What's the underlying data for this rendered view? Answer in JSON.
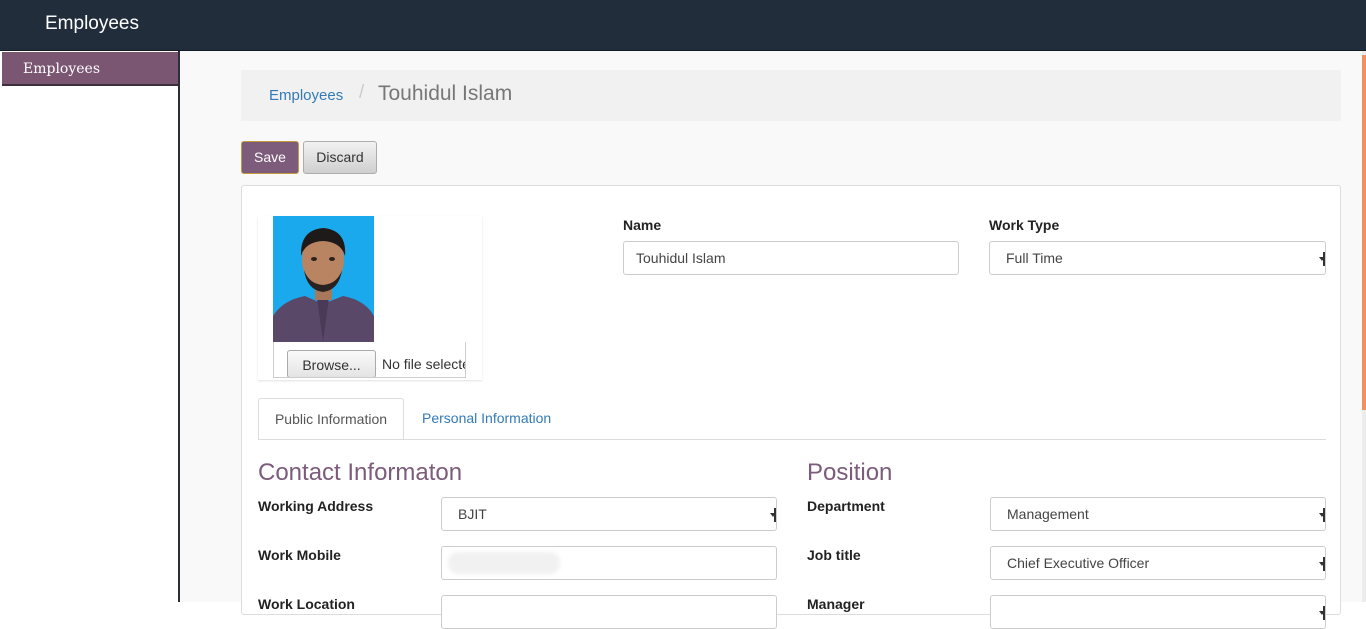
{
  "app": {
    "title": "Employees"
  },
  "sidebar": {
    "items": [
      {
        "label": "Employees"
      }
    ]
  },
  "breadcrumb": {
    "parent": "Employees",
    "separator": "/",
    "current": "Touhidul Islam"
  },
  "toolbar": {
    "save_label": "Save",
    "discard_label": "Discard"
  },
  "photo": {
    "browse_label": "Browse...",
    "file_status": "No file selected."
  },
  "fields": {
    "name": {
      "label": "Name",
      "value": "Touhidul Islam"
    },
    "work_type": {
      "label": "Work Type",
      "value": "Full Time"
    }
  },
  "tabs": [
    {
      "label": "Public Information"
    },
    {
      "label": "Personal Information"
    }
  ],
  "contact": {
    "title": "Contact Informaton",
    "working_address": {
      "label": "Working Address",
      "value": "BJIT"
    },
    "work_mobile": {
      "label": "Work Mobile",
      "value": ""
    },
    "work_location": {
      "label": "Work Location"
    }
  },
  "position": {
    "title": "Position",
    "department": {
      "label": "Department",
      "value": "Management"
    },
    "job_title": {
      "label": "Job title",
      "value": "Chief Executive Officer"
    },
    "manager": {
      "label": "Manager"
    }
  },
  "colors": {
    "topbar": "#222d3c",
    "accent": "#7c5b7b",
    "link": "#337ab7",
    "scroll": "#f0915e"
  }
}
